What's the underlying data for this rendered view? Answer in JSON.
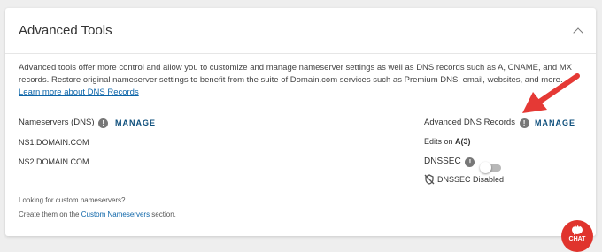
{
  "card": {
    "title": "Advanced Tools",
    "description": "Advanced tools offer more control and allow you to customize and manage nameserver settings as well as DNS records such as A, CNAME, and MX records. Restore original nameserver settings to benefit from the suite of Domain.com services such as Premium DNS, email, websites, and more. ",
    "learn_more_link": "Learn more about DNS Records"
  },
  "nameservers": {
    "label": "Nameservers (DNS)",
    "manage_label": "MANAGE",
    "items": [
      "NS1.DOMAIN.COM",
      "NS2.DOMAIN.COM"
    ]
  },
  "advanced_dns": {
    "label": "Advanced DNS Records",
    "manage_label": "MANAGE",
    "edits_prefix": "Edits on ",
    "edits_value": "A(3)",
    "dnssec_label": "DNSSEC",
    "dnssec_status": "DNSSEC Disabled",
    "dnssec_enabled": false
  },
  "footer": {
    "line1": "Looking for custom nameservers?",
    "line2_prefix": "Create them on the ",
    "line2_link": "Custom Nameservers",
    "line2_suffix": " section."
  },
  "chat": {
    "label": "CHAT"
  },
  "annotation": {
    "arrow_color": "#e53935"
  }
}
